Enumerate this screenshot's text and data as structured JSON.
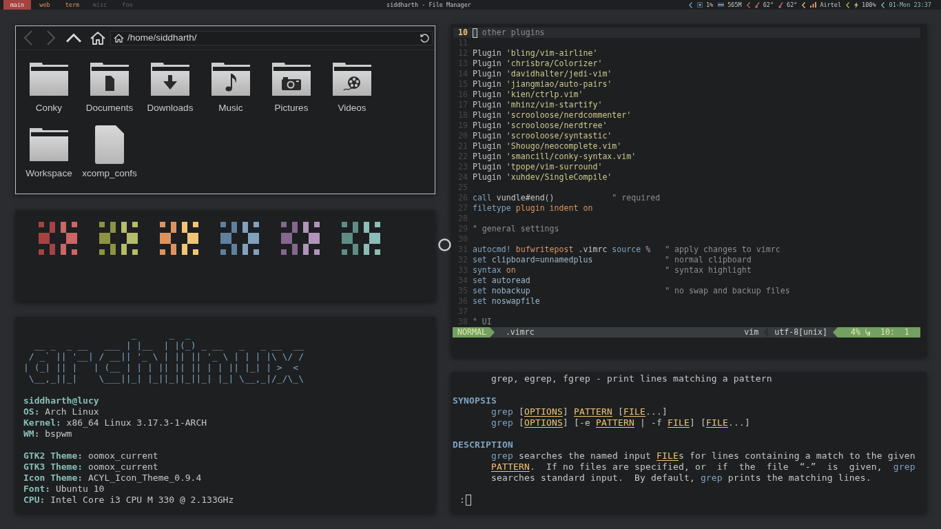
{
  "topbar": {
    "workspaces": [
      {
        "label": "main",
        "selected": true,
        "occupied": true
      },
      {
        "label": "web",
        "selected": false,
        "occupied": true
      },
      {
        "label": "term",
        "selected": false,
        "occupied": true
      },
      {
        "label": "misc",
        "selected": false,
        "occupied": false
      },
      {
        "label": "foo",
        "selected": false,
        "occupied": false
      }
    ],
    "title": "siddharth - File Manager",
    "status": [
      {
        "color": "#81a2be",
        "entries": [
          {
            "kind": "cpu",
            "text": "1%"
          },
          {
            "kind": "memory",
            "text": "565M"
          }
        ]
      },
      {
        "color": "#cc6666",
        "entries": [
          {
            "kind": "temperature",
            "text": "62°"
          },
          {
            "kind": "temperature",
            "text": "62°"
          }
        ]
      },
      {
        "color": "#f0c674",
        "entries": [
          {
            "kind": "signal",
            "text": "Airtel"
          }
        ]
      },
      {
        "color": "#b5bd68",
        "entries": [
          {
            "kind": "battery",
            "text": "100%"
          }
        ]
      },
      {
        "color": "#8abeb7",
        "entries": [
          {
            "kind": "clock",
            "text": "01-Mon 23:37"
          }
        ]
      }
    ]
  },
  "file_manager": {
    "nav_buttons": [
      {
        "kind": "back",
        "disabled": true
      },
      {
        "kind": "forward",
        "disabled": true
      },
      {
        "kind": "up",
        "disabled": false
      },
      {
        "kind": "home",
        "disabled": false
      }
    ],
    "location": "/home/siddharth/",
    "items": [
      {
        "name": "Conky",
        "kind": "folder"
      },
      {
        "name": "Documents",
        "kind": "documents"
      },
      {
        "name": "Downloads",
        "kind": "downloads"
      },
      {
        "name": "Music",
        "kind": "music"
      },
      {
        "name": "Pictures",
        "kind": "pictures"
      },
      {
        "name": "Videos",
        "kind": "videos"
      },
      {
        "name": "Workspace",
        "kind": "folder"
      },
      {
        "name": "xcomp_confs",
        "kind": "file"
      }
    ]
  },
  "palette": [
    {
      "swatches": [
        {
          "color": "#a54242"
        },
        {
          "color": "#cc6666"
        }
      ]
    },
    {
      "swatches": [
        {
          "color": "#8c9440"
        },
        {
          "color": "#b5bd68"
        }
      ]
    },
    {
      "swatches": [
        {
          "color": "#de935f"
        },
        {
          "color": "#f0c674"
        }
      ]
    },
    {
      "swatches": [
        {
          "color": "#5f819d"
        },
        {
          "color": "#81a2be"
        }
      ]
    },
    {
      "swatches": [
        {
          "color": "#85678f"
        },
        {
          "color": "#b294bb"
        }
      ]
    },
    {
      "swatches": [
        {
          "color": "#5e8d87"
        },
        {
          "color": "#8abeb7"
        }
      ]
    }
  ],
  "sysinfo": {
    "logo": [
      "                    _      _  _",
      "  __ _  _ __   ___ | |__  | |(_) _ __   _   _ __  __",
      " / _` || '__| / __|| '_ \\ | || || '_ \\ | | | |\\ \\/ /",
      "| (_| || |   | (__ | | | || || || | | || |_| | >  <",
      " \\__,_||_|    \\___||_| |_||_||_||_| |_| \\__,_|/_/\\_\\"
    ],
    "user_host": "siddharth@lucy",
    "sections": [
      {
        "fields": [
          {
            "label": "OS:",
            "value": "Arch Linux"
          },
          {
            "label": "Kernel:",
            "value": "x86_64 Linux 3.17.3-1-ARCH"
          },
          {
            "label": "WM:",
            "value": "bspwm"
          }
        ]
      },
      {
        "fields": [
          {
            "label": "GTK2 Theme:",
            "value": "oomox_current"
          },
          {
            "label": "GTK3 Theme:",
            "value": "oomox_current"
          },
          {
            "label": "Icon Theme:",
            "value": "ACYL_Icon_Theme_0.9.4"
          },
          {
            "label": "Font:",
            "value": "Ubuntu 10"
          },
          {
            "label": "CPU:",
            "value": "Intel Core i3 CPU M 330 @ 2.133GHz"
          }
        ]
      }
    ]
  },
  "editor": {
    "lines": [
      {
        "number": "10",
        "current": true,
        "segments": [
          {
            "kind": "comment",
            "text": " other plugins"
          }
        ]
      },
      {
        "number": "11",
        "current": false
      },
      {
        "number": "12",
        "current": false,
        "segments": [
          {
            "kind": "text",
            "text": "Plugin "
          },
          {
            "kind": "string",
            "text": "'bling/vim-airline'"
          }
        ]
      },
      {
        "number": "13",
        "current": false,
        "segments": [
          {
            "kind": "text",
            "text": "Plugin "
          },
          {
            "kind": "string",
            "text": "'chrisbra/Colorizer'"
          }
        ]
      },
      {
        "number": "14",
        "current": false,
        "segments": [
          {
            "kind": "text",
            "text": "Plugin "
          },
          {
            "kind": "string",
            "text": "'davidhalter/jedi-vim'"
          }
        ]
      },
      {
        "number": "15",
        "current": false,
        "segments": [
          {
            "kind": "text",
            "text": "Plugin "
          },
          {
            "kind": "string",
            "text": "'jiangmiao/auto-pairs'"
          }
        ]
      },
      {
        "number": "16",
        "current": false,
        "segments": [
          {
            "kind": "text",
            "text": "Plugin "
          },
          {
            "kind": "string",
            "text": "'kien/ctrlp.vim'"
          }
        ]
      },
      {
        "number": "17",
        "current": false,
        "segments": [
          {
            "kind": "text",
            "text": "Plugin "
          },
          {
            "kind": "string",
            "text": "'mhinz/vim-startify'"
          }
        ]
      },
      {
        "number": "18",
        "current": false,
        "segments": [
          {
            "kind": "text",
            "text": "Plugin "
          },
          {
            "kind": "string",
            "text": "'scrooloose/nerdcommenter'"
          }
        ]
      },
      {
        "number": "19",
        "current": false,
        "segments": [
          {
            "kind": "text",
            "text": "Plugin "
          },
          {
            "kind": "string",
            "text": "'scrooloose/nerdtree'"
          }
        ]
      },
      {
        "number": "20",
        "current": false,
        "segments": [
          {
            "kind": "text",
            "text": "Plugin "
          },
          {
            "kind": "string",
            "text": "'scrooloose/syntastic'"
          }
        ]
      },
      {
        "number": "21",
        "current": false,
        "segments": [
          {
            "kind": "text",
            "text": "Plugin "
          },
          {
            "kind": "string",
            "text": "'Shougo/neocomplete.vim'"
          }
        ]
      },
      {
        "number": "22",
        "current": false,
        "segments": [
          {
            "kind": "text",
            "text": "Plugin "
          },
          {
            "kind": "string",
            "text": "'smancill/conky-syntax.vim'"
          }
        ]
      },
      {
        "number": "23",
        "current": false,
        "segments": [
          {
            "kind": "text",
            "text": "Plugin "
          },
          {
            "kind": "string",
            "text": "'tpope/vim-surround'"
          }
        ]
      },
      {
        "number": "24",
        "current": false,
        "segments": [
          {
            "kind": "text",
            "text": "Plugin "
          },
          {
            "kind": "string",
            "text": "'xuhdev/SingleCompile'"
          }
        ]
      },
      {
        "number": "25",
        "current": false
      },
      {
        "number": "26",
        "current": false,
        "segments": [
          {
            "kind": "keyword",
            "text": "call"
          },
          {
            "kind": "text",
            "text": " vundle#end()"
          },
          {
            "kind": "comment",
            "text": "            \" required"
          }
        ]
      },
      {
        "number": "27",
        "current": false,
        "segments": [
          {
            "kind": "keyword",
            "text": "filetype"
          },
          {
            "kind": "special",
            "text": " plugin indent on"
          }
        ]
      },
      {
        "number": "28",
        "current": false
      },
      {
        "number": "29",
        "current": false,
        "segments": [
          {
            "kind": "comment",
            "text": "\" general settings"
          }
        ]
      },
      {
        "number": "30",
        "current": false
      },
      {
        "number": "31",
        "current": false,
        "segments": [
          {
            "kind": "keyword",
            "text": "autocmd!"
          },
          {
            "kind": "special",
            "text": " bufwritepost"
          },
          {
            "kind": "text",
            "text": " .vimrc"
          },
          {
            "kind": "keyword",
            "text": " source"
          },
          {
            "kind": "operator",
            "text": " %"
          },
          {
            "kind": "comment",
            "text": "   \" apply changes to vimrc"
          }
        ]
      },
      {
        "number": "32",
        "current": false,
        "segments": [
          {
            "kind": "keyword",
            "text": "set"
          },
          {
            "kind": "option",
            "text": " clipboard=unnamedplus"
          },
          {
            "kind": "comment",
            "text": "               \" normal clipboard"
          }
        ]
      },
      {
        "number": "33",
        "current": false,
        "segments": [
          {
            "kind": "keyword",
            "text": "syntax"
          },
          {
            "kind": "special",
            "text": " on"
          },
          {
            "kind": "comment",
            "text": "                               \" syntax highlight"
          }
        ]
      },
      {
        "number": "34",
        "current": false,
        "segments": [
          {
            "kind": "keyword",
            "text": "set"
          },
          {
            "kind": "option",
            "text": " autoread"
          }
        ]
      },
      {
        "number": "35",
        "current": false,
        "segments": [
          {
            "kind": "keyword",
            "text": "set"
          },
          {
            "kind": "option",
            "text": " nobackup"
          },
          {
            "kind": "comment",
            "text": "                            \" no swap and backup files"
          }
        ]
      },
      {
        "number": "36",
        "current": false,
        "segments": [
          {
            "kind": "keyword",
            "text": "set"
          },
          {
            "kind": "option",
            "text": " noswapfile"
          }
        ]
      },
      {
        "number": "37",
        "current": false
      },
      {
        "number": "38",
        "current": false,
        "segments": [
          {
            "kind": "comment",
            "text": "\" UI"
          }
        ]
      }
    ],
    "statusline": {
      "mode": "NORMAL",
      "file": ".vimrc",
      "filetype": "vim",
      "encoding": "utf-8[unix]",
      "percent": "4%",
      "position": "10:  1"
    }
  },
  "manpage": {
    "blocks": [
      {
        "lines": [
          {
            "kind": "body",
            "segments": [
              {
                "kind": "text",
                "text": "grep, egrep, fgrep - print lines matching a pattern"
              }
            ]
          }
        ]
      },
      {
        "lines": [
          {
            "kind": "heading",
            "text": "SYNOPSIS"
          },
          {
            "kind": "body",
            "segments": [
              {
                "kind": "command",
                "text": "grep"
              },
              {
                "kind": "text",
                "text": " ["
              },
              {
                "kind": "arg",
                "text": "OPTIONS"
              },
              {
                "kind": "text",
                "text": "] "
              },
              {
                "kind": "arg",
                "text": "PATTERN"
              },
              {
                "kind": "text",
                "text": " ["
              },
              {
                "kind": "arg",
                "text": "FILE"
              },
              {
                "kind": "text",
                "text": "...]"
              }
            ]
          },
          {
            "kind": "body",
            "segments": [
              {
                "kind": "command",
                "text": "grep"
              },
              {
                "kind": "text",
                "text": " ["
              },
              {
                "kind": "arg",
                "text": "OPTIONS"
              },
              {
                "kind": "text",
                "text": "] [-e "
              },
              {
                "kind": "arg",
                "text": "PATTERN"
              },
              {
                "kind": "text",
                "text": " | -f "
              },
              {
                "kind": "arg",
                "text": "FILE"
              },
              {
                "kind": "text",
                "text": "] ["
              },
              {
                "kind": "arg",
                "text": "FILE"
              },
              {
                "kind": "text",
                "text": "...]"
              }
            ]
          }
        ]
      },
      {
        "lines": [
          {
            "kind": "heading",
            "text": "DESCRIPTION"
          },
          {
            "kind": "body",
            "segments": [
              {
                "kind": "command",
                "text": "grep"
              },
              {
                "kind": "text",
                "text": " searches the named input "
              },
              {
                "kind": "arg",
                "text": "FILE"
              },
              {
                "kind": "text",
                "text": "s for lines containing a match to the given"
              }
            ]
          },
          {
            "kind": "body",
            "segments": [
              {
                "kind": "arg",
                "text": "PATTERN"
              },
              {
                "kind": "text",
                "text": ".  If no files are specified, or  if  the  file  “-”  is  given,  "
              },
              {
                "kind": "command",
                "text": "grep"
              }
            ]
          },
          {
            "kind": "body",
            "segments": [
              {
                "kind": "text",
                "text": "searches standard input.  By default, "
              },
              {
                "kind": "command",
                "text": "grep"
              },
              {
                "kind": "text",
                "text": " prints the matching lines."
              }
            ]
          }
        ]
      }
    ],
    "prompt": ":"
  }
}
